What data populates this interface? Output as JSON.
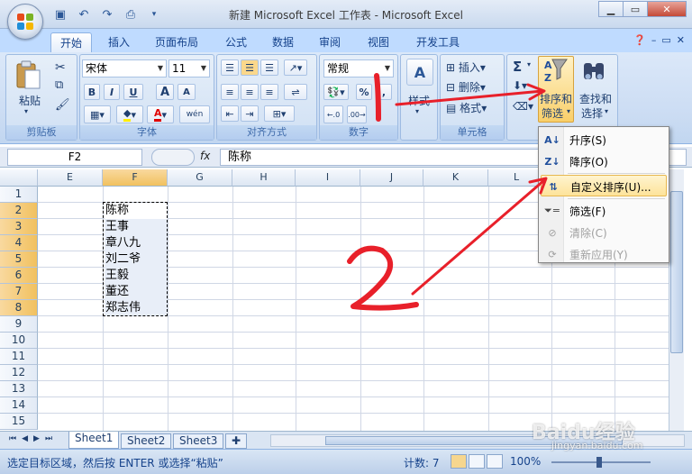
{
  "title_bar": {
    "title": "新建 Microsoft Excel 工作表 - Microsoft Excel",
    "minimize": "▁",
    "restore": "▭",
    "close": "✕"
  },
  "ribbon_tabs": [
    "开始",
    "插入",
    "页面布局",
    "公式",
    "数据",
    "审阅",
    "视图",
    "开发工具"
  ],
  "clipboard": {
    "paste": "粘贴",
    "label": "剪贴板"
  },
  "font": {
    "name": "宋体",
    "size": "11",
    "label": "字体",
    "bold": "B",
    "italic": "I",
    "underline": "U",
    "grow": "A",
    "shrink": "A",
    "color": "A",
    "phonetic": "wén"
  },
  "alignment": {
    "label": "对齐方式"
  },
  "number": {
    "format": "常规",
    "label": "数字",
    "percent": "%",
    "comma": ",",
    "inc_dec": ".0\n.00",
    "dec_dec": ".00\n.0"
  },
  "styles": {
    "label": "样式"
  },
  "cells_group": {
    "insert": "插入",
    "delete": "删除",
    "format": "格式",
    "label": "单元格"
  },
  "editing": {
    "sum": "Σ",
    "sort_filter_line1": "排序和",
    "sort_filter_line2": "筛选",
    "find_line1": "查找和",
    "find_line2": "选择"
  },
  "formula_bar": {
    "name_box": "F2",
    "fx": "fx",
    "value": "陈称"
  },
  "columns": [
    "E",
    "F",
    "G",
    "H",
    "I",
    "J",
    "K",
    "L"
  ],
  "rows": [
    "1",
    "2",
    "3",
    "4",
    "5",
    "6",
    "7",
    "8",
    "9",
    "10",
    "11",
    "12",
    "13",
    "14",
    "15"
  ],
  "cells": [
    "陈称",
    "王事",
    "章八九",
    "刘二爷",
    "王毅",
    "董还",
    "郑志伟"
  ],
  "menu": {
    "asc": "升序(S)",
    "desc": "降序(O)",
    "custom": "自定义排序(U)...",
    "filter": "筛选(F)",
    "clear": "清除(C)",
    "reapply": "重新应用(Y)"
  },
  "sheets": [
    "Sheet1",
    "Sheet2",
    "Sheet3"
  ],
  "status": {
    "message": "选定目标区域，然后按 ENTER 或选择“粘贴”",
    "count": "计数: 7",
    "zoom": "100%"
  },
  "watermark": {
    "brand": "Baidu经验",
    "url": "jingyan.baidu.com"
  },
  "colors": {
    "ribbon": "#dbe8f9",
    "annotation": "#e8202a",
    "highlight": "#fde39a"
  }
}
